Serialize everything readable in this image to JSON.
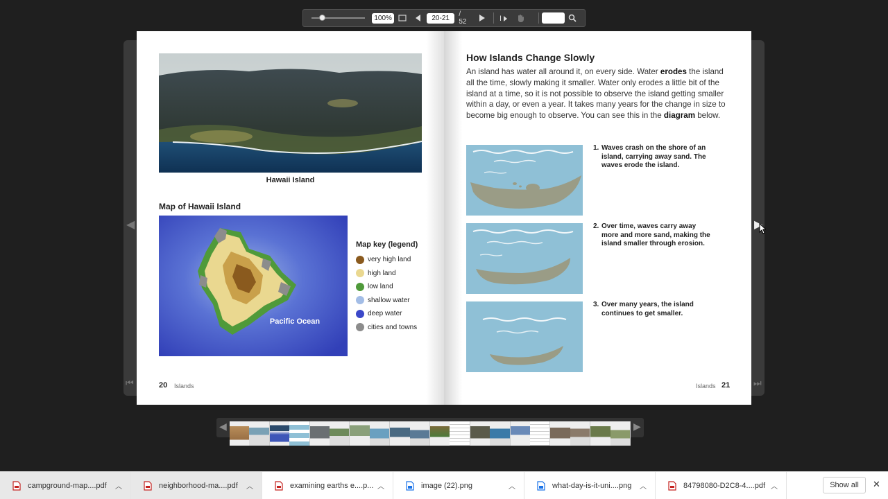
{
  "viewer": {
    "zoom_level": "100%",
    "zoom_fraction": 0.15,
    "page_field": "20-21",
    "page_total": "/ 52",
    "search_placeholder": ""
  },
  "left_page": {
    "photo_caption": "Hawaii Island",
    "map_title": "Map of Hawaii Island",
    "map_ocean_label": "Pacific Ocean",
    "legend_title": "Map key (legend)",
    "legend": [
      {
        "label": "very high land",
        "color": "#8a5a1e"
      },
      {
        "label": "high land",
        "color": "#ead890"
      },
      {
        "label": "low land",
        "color": "#4f9a3a"
      },
      {
        "label": "shallow water",
        "color": "#a3bde6"
      },
      {
        "label": "deep water",
        "color": "#3b48c9"
      },
      {
        "label": "cities and towns",
        "color": "#8c8c8c"
      }
    ],
    "page_number": "20",
    "section": "Islands"
  },
  "right_page": {
    "heading": "How Islands Change Slowly",
    "body": {
      "p1": "An island has water all around it, on every side. Water ",
      "b1": "erodes",
      "p2": " the island all the time, slowly making it smaller. Water only erodes a little bit of the island at a time, so it is not possible to observe the island getting smaller within a day, or even a year. It takes many years for the change in size to become big enough to observe. You can see this in the ",
      "b2": "diagram",
      "p3": " below."
    },
    "steps": [
      {
        "num": "1.",
        "text": "Waves crash on the shore of an island, carrying away sand. The waves erode the island."
      },
      {
        "num": "2.",
        "text": "Over time, waves carry away more and more sand, making the island smaller through erosion."
      },
      {
        "num": "3.",
        "text": "Over many years, the island continues to get smaller."
      }
    ],
    "page_number": "21",
    "section": "Islands"
  },
  "downloads": {
    "items": [
      {
        "name": "campground-map....pdf",
        "type": "pdf"
      },
      {
        "name": "neighborhood-ma....pdf",
        "type": "pdf"
      },
      {
        "name": "examining earths e....p...",
        "type": "pdf"
      },
      {
        "name": "image (22).png",
        "type": "png"
      },
      {
        "name": "what-day-is-it-uni....png",
        "type": "png"
      },
      {
        "name": "84798080-D2C8-4....pdf",
        "type": "pdf"
      }
    ],
    "show_all": "Show all"
  },
  "colors": {
    "ocean": "#8fc0d6",
    "island": "#9a9c86",
    "pdf_icon": "#c5221f",
    "png_icon": "#1a73e8"
  }
}
